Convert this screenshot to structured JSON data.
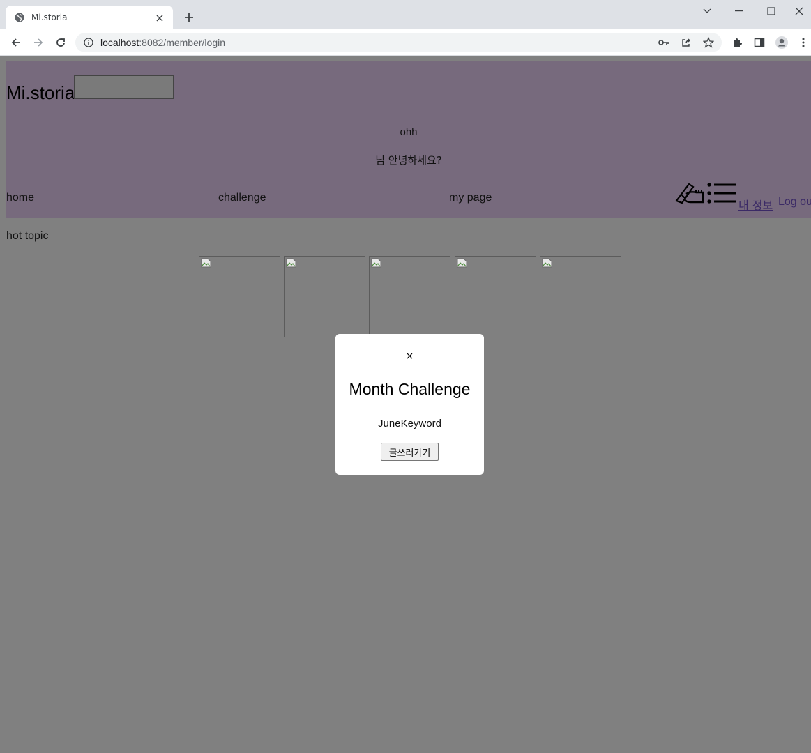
{
  "browser": {
    "tab_title": "Mi.storia",
    "tab_close": "×",
    "new_tab": "+",
    "url_host": "localhost",
    "url_path": ":8082/member/login"
  },
  "header": {
    "logo": "Mi.storia",
    "greeting_name": "ohh",
    "greeting_message": "님 안녕하세요?",
    "nav": {
      "home": "home",
      "challenge": "challenge",
      "my_page": "my page"
    },
    "links": {
      "my_info": "내 정보",
      "logout": "Log ou"
    },
    "background_color": "#776a7d"
  },
  "main": {
    "hot_topic_label": "hot topic",
    "thumbnails": [
      "broken-image",
      "broken-image",
      "broken-image",
      "broken-image",
      "broken-image"
    ]
  },
  "modal": {
    "close_label": "×",
    "title": "Month Challenge",
    "keyword": "JuneKeyword",
    "button_label": "글쓰러가기"
  },
  "colors": {
    "overlay": "#808080",
    "modal_bg": "#ffffff",
    "link": "#3b2a66"
  }
}
